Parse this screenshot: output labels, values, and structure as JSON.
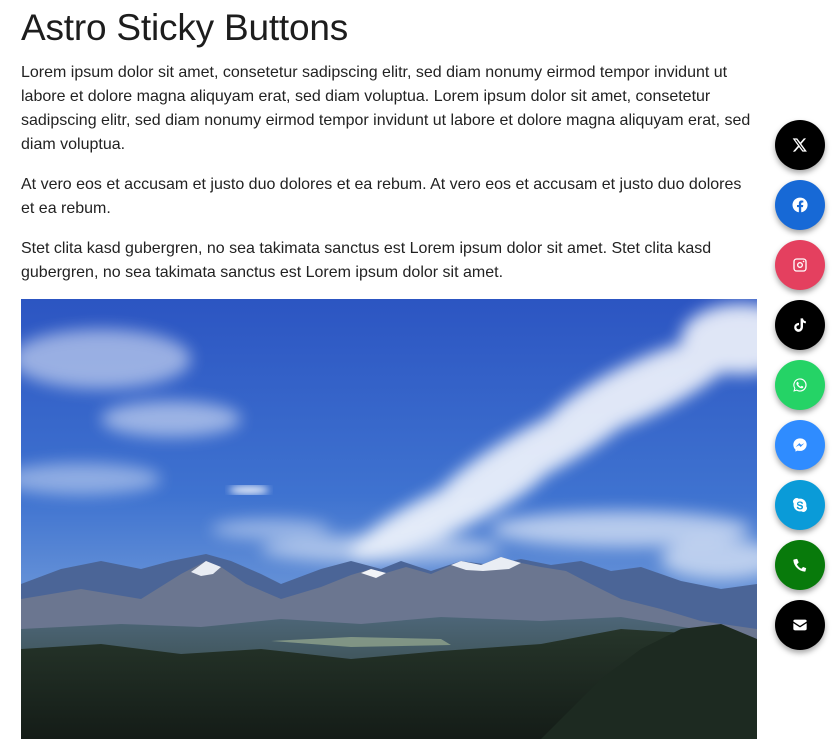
{
  "page": {
    "title": "Astro Sticky Buttons",
    "paragraphs": [
      "Lorem ipsum dolor sit amet, consetetur sadipscing elitr, sed diam nonumy eirmod tempor invidunt ut labore et dolore magna aliquyam erat, sed diam voluptua. Lorem ipsum dolor sit amet, consetetur sadipscing elitr, sed diam nonumy eirmod tempor invidunt ut labore et dolore magna aliquyam erat, sed diam voluptua.",
      "At vero eos et accusam et justo duo dolores et ea rebum. At vero eos et accusam et justo duo dolores et ea rebum.",
      "Stet clita kasd gubergren, no sea takimata sanctus est Lorem ipsum dolor sit amet. Stet clita kasd gubergren, no sea takimata sanctus est Lorem ipsum dolor sit amet."
    ]
  },
  "sticky_buttons": [
    {
      "name": "x",
      "icon": "x-icon",
      "color": "#000000"
    },
    {
      "name": "facebook",
      "icon": "facebook-icon",
      "color": "#1769d6"
    },
    {
      "name": "instagram",
      "icon": "instagram-icon",
      "color": "#e4405f"
    },
    {
      "name": "tiktok",
      "icon": "tiktok-icon",
      "color": "#000000"
    },
    {
      "name": "whatsapp",
      "icon": "whatsapp-icon",
      "color": "#25d366"
    },
    {
      "name": "messenger",
      "icon": "messenger-icon",
      "color": "#2f8cff"
    },
    {
      "name": "skype",
      "icon": "skype-icon",
      "color": "#0a9bd8"
    },
    {
      "name": "phone",
      "icon": "phone-icon",
      "color": "#087a0b"
    },
    {
      "name": "email",
      "icon": "envelope-icon",
      "color": "#000000"
    }
  ]
}
